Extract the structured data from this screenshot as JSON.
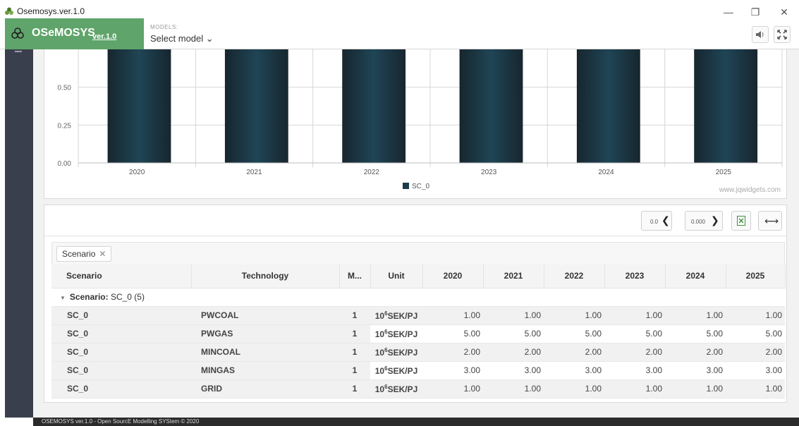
{
  "window": {
    "title": "Osemosys.ver.1.0",
    "minimize": "—",
    "restore": "❐",
    "close": "✕"
  },
  "header": {
    "brand_name": "OSeMOSYS",
    "brand_version": "ver.1.0",
    "models_label": "MODELS:",
    "model_select": "Select model ⌄",
    "sound_icon": "sound-icon",
    "fullscreen_icon": "expand-icon",
    "brand_color": "#5fa46a"
  },
  "chart_data": {
    "type": "bar",
    "categories": [
      "2020",
      "2021",
      "2022",
      "2023",
      "2024",
      "2025"
    ],
    "series": [
      {
        "name": "SC_0",
        "values": [
          1.0,
          1.0,
          1.0,
          1.0,
          1.0,
          1.0
        ]
      }
    ],
    "y_ticks": [
      "0.00",
      "0.25",
      "0.50"
    ],
    "ylim": [
      0,
      0.75
    ],
    "visible_portion": "lower part of chart only (scrolled)",
    "legend_position": "bottom-center",
    "bar_color": "#1c3a4a",
    "grid": true,
    "watermark": "www.jqwidgets.com"
  },
  "toolbar": {
    "decimal_down": "0.0",
    "decimal_up": "0.000",
    "arrow_left": "❮",
    "arrow_right": "❯",
    "excel_icon": "excel-icon",
    "expand_icon": "horizontal-expand-icon",
    "expand_label": "⟷"
  },
  "grid": {
    "group_chip": "Scenario",
    "group_chip_remove": "✕",
    "columns": [
      "Scenario",
      "Technology",
      "M...",
      "Unit",
      "2020",
      "2021",
      "2022",
      "2023",
      "2024",
      "2025"
    ],
    "group_label": "Scenario:",
    "group_value": "SC_0 (5)",
    "rows": [
      {
        "scenario": "SC_0",
        "technology": "PWCOAL",
        "m": "1",
        "unit_base": "10",
        "unit_exp": "6",
        "unit_rest": "SEK/PJ",
        "values": [
          "1.00",
          "1.00",
          "1.00",
          "1.00",
          "1.00",
          "1.00"
        ]
      },
      {
        "scenario": "SC_0",
        "technology": "PWGAS",
        "m": "1",
        "unit_base": "10",
        "unit_exp": "6",
        "unit_rest": "SEK/PJ",
        "values": [
          "5.00",
          "5.00",
          "5.00",
          "5.00",
          "5.00",
          "5.00"
        ]
      },
      {
        "scenario": "SC_0",
        "technology": "MINCOAL",
        "m": "1",
        "unit_base": "10",
        "unit_exp": "6",
        "unit_rest": "SEK/PJ",
        "values": [
          "2.00",
          "2.00",
          "2.00",
          "2.00",
          "2.00",
          "2.00"
        ]
      },
      {
        "scenario": "SC_0",
        "technology": "MINGAS",
        "m": "1",
        "unit_base": "10",
        "unit_exp": "6",
        "unit_rest": "SEK/PJ",
        "values": [
          "3.00",
          "3.00",
          "3.00",
          "3.00",
          "3.00",
          "3.00"
        ]
      },
      {
        "scenario": "SC_0",
        "technology": "GRID",
        "m": "1",
        "unit_base": "10",
        "unit_exp": "6",
        "unit_rest": "SEK/PJ",
        "values": [
          "1.00",
          "1.00",
          "1.00",
          "1.00",
          "1.00",
          "1.00"
        ]
      }
    ]
  },
  "footer": {
    "text": "OSEMOSYS ver.1.0 - Open SourcE Modelling SYStem © 2020"
  }
}
